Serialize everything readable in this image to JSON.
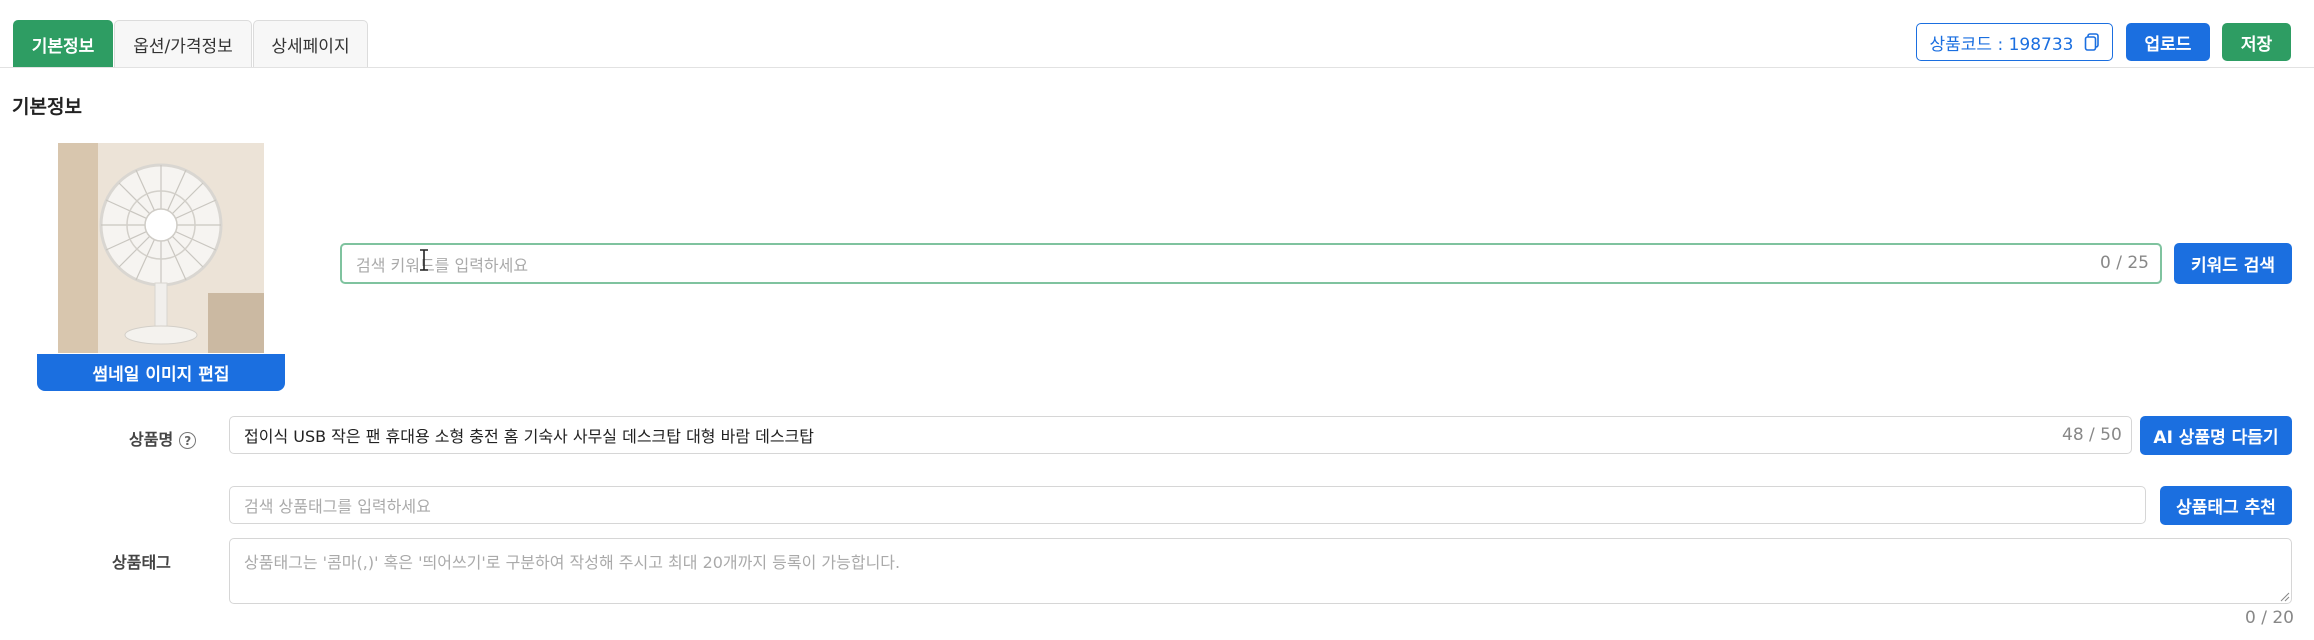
{
  "tabs": [
    "기본정보",
    "옵션/가격정보",
    "상세페이지"
  ],
  "header": {
    "product_code": "상품코드 : 198733",
    "upload_label": "업로드",
    "save_label": "저장"
  },
  "section_title": "기본정보",
  "thumbnail": {
    "edit_label": "썸네일 이미지 편집"
  },
  "keyword_search": {
    "placeholder": "검색 키워드를 입력하세요",
    "counter": "0 / 25",
    "button_label": "키워드 검색"
  },
  "product_name": {
    "label": "상품명",
    "help": "?",
    "value": "접이식 USB 작은 팬 휴대용 소형 충전 홈 기숙사 사무실 데스크탑 대형 바람 데스크탑",
    "counter": "48 / 50",
    "button_label": "AI 상품명 다듬기"
  },
  "product_tag": {
    "search_placeholder": "검색 상품태그를 입력하세요",
    "recommend_label": "상품태그 추천",
    "label": "상품태그",
    "textarea_placeholder": "상품태그는 '콤마(,)' 혹은 '띄어쓰기'로 구분하여 작성해 주시고 최대 20개까지 등록이 가능합니다.",
    "counter": "0 / 20"
  },
  "colors": {
    "accent_green": "#2e9d63",
    "accent_blue": "#1b6fe0"
  }
}
